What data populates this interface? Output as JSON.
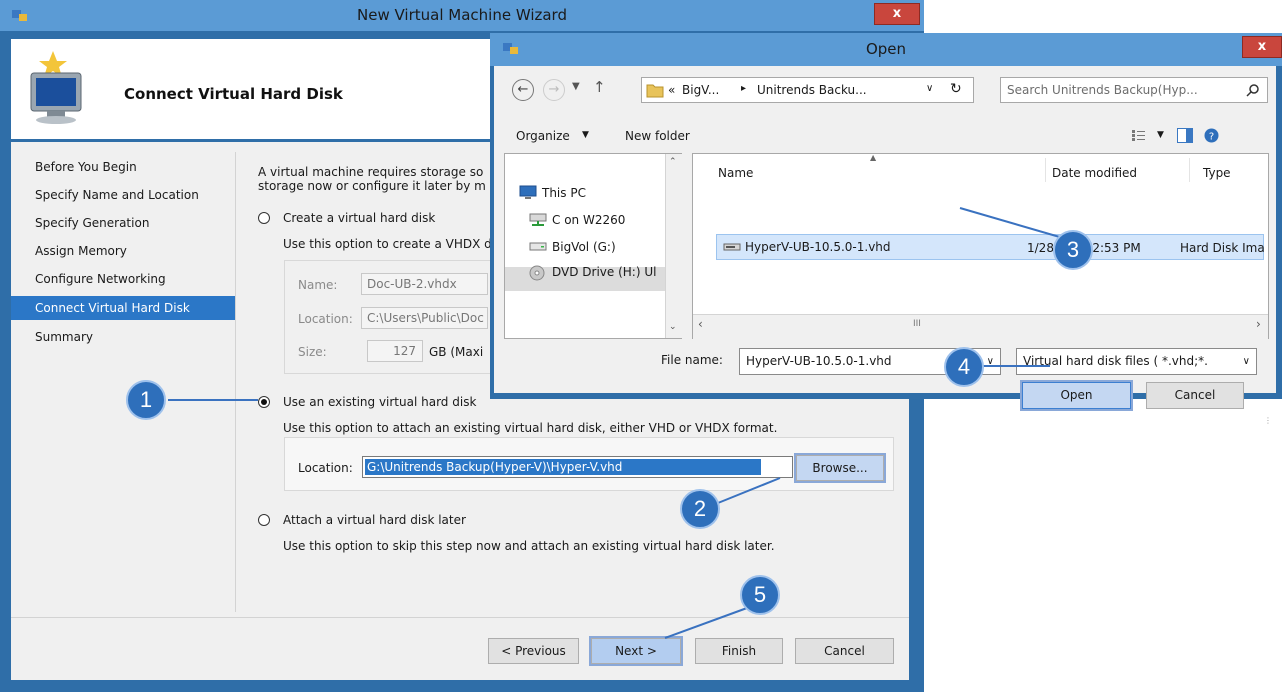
{
  "wizard": {
    "title": "New Virtual Machine Wizard",
    "page_title": "Connect Virtual Hard Disk",
    "nav": [
      {
        "label": "Before You Begin"
      },
      {
        "label": "Specify Name and Location"
      },
      {
        "label": "Specify Generation"
      },
      {
        "label": "Assign Memory"
      },
      {
        "label": "Configure Networking"
      },
      {
        "label": "Connect Virtual Hard Disk",
        "active": true
      },
      {
        "label": "Summary"
      }
    ],
    "intro_line1": "A virtual machine requires storage so",
    "intro_line2": "storage now or configure it later by m",
    "options": {
      "create": {
        "label": "Create a virtual hard disk",
        "description": "Use this option to create a VHDX d",
        "name_label": "Name:",
        "name_value": "Doc-UB-2.vhdx",
        "location_label": "Location:",
        "location_value": "C:\\Users\\Public\\Doc",
        "size_label": "Size:",
        "size_value": "127",
        "size_unit": "GB (Maxi"
      },
      "existing": {
        "label": "Use an existing virtual hard disk",
        "description": "Use this option to attach an existing virtual hard disk, either VHD or VHDX format.",
        "location_label": "Location:",
        "location_value": "G:\\Unitrends Backup(Hyper-V)\\Hyper-V.vhd",
        "browse_label": "Browse..."
      },
      "later": {
        "label": "Attach a virtual hard disk later",
        "description": "Use this option to skip this step now and attach an existing virtual hard disk later."
      }
    },
    "buttons": {
      "previous": "< Previous",
      "next": "Next >",
      "finish": "Finish",
      "cancel": "Cancel"
    },
    "close_glyph": "x"
  },
  "open_dialog": {
    "title": "Open",
    "close_glyph": "x",
    "address": {
      "prefix": "«",
      "crumb1": "BigV...",
      "separator": "▸",
      "crumb2": "Unitrends Backu..."
    },
    "search_placeholder": "Search Unitrends Backup(Hyp...",
    "toolbar": {
      "organize": "Organize",
      "new_folder": "New folder"
    },
    "tree": [
      {
        "label": "This PC",
        "icon": "computer-icon"
      },
      {
        "label": "C on W2260",
        "icon": "network-drive-icon"
      },
      {
        "label": "BigVol (G:)",
        "icon": "drive-icon",
        "selected": true
      },
      {
        "label": "DVD Drive (H:) Ul",
        "icon": "dvd-drive-icon"
      }
    ],
    "columns": {
      "name": "Name",
      "date_modified": "Date modified",
      "type": "Type"
    },
    "files": [
      {
        "name": "HyperV-UB-10.5.0-1.vhd",
        "date_modified": "1/28/2021 2:53 PM",
        "type": "Hard Disk Ima"
      }
    ],
    "file_name_label": "File name:",
    "file_name_value": "HyperV-UB-10.5.0-1.vhd",
    "file_type_value": "Virtual hard disk files  ( *.vhd;*.",
    "buttons": {
      "open": "Open",
      "cancel": "Cancel"
    }
  },
  "callouts": [
    "1",
    "2",
    "3",
    "4",
    "5"
  ],
  "colors": {
    "window_border": "#2f6ea8",
    "titlebar": "#5b9bd5",
    "selection": "#2b77c7",
    "callout": "#2e6fbb",
    "close_button": "#c9463d"
  }
}
